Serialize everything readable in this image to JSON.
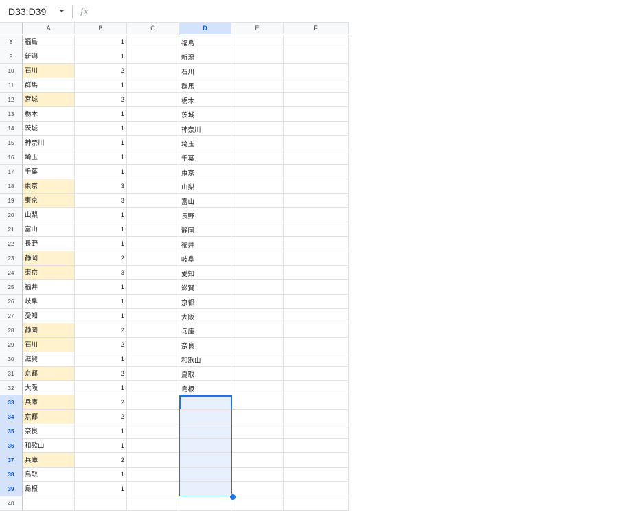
{
  "name_box": {
    "value": "D33:D39"
  },
  "formula_bar": {
    "fx_label": "fx",
    "value": ""
  },
  "columns": [
    "A",
    "B",
    "C",
    "D",
    "E",
    "F"
  ],
  "rows": [
    {
      "num": "8",
      "a": "福島",
      "b": "1",
      "d": "福島",
      "hl": false
    },
    {
      "num": "9",
      "a": "新潟",
      "b": "1",
      "d": "新潟",
      "hl": false
    },
    {
      "num": "10",
      "a": "石川",
      "b": "2",
      "d": "石川",
      "hl": true
    },
    {
      "num": "11",
      "a": "群馬",
      "b": "1",
      "d": "群馬",
      "hl": false
    },
    {
      "num": "12",
      "a": "宮城",
      "b": "2",
      "d": "栃木",
      "hl": true
    },
    {
      "num": "13",
      "a": "栃木",
      "b": "1",
      "d": "茨城",
      "hl": false
    },
    {
      "num": "14",
      "a": "茨城",
      "b": "1",
      "d": "神奈川",
      "hl": false
    },
    {
      "num": "15",
      "a": "神奈川",
      "b": "1",
      "d": "埼玉",
      "hl": false
    },
    {
      "num": "16",
      "a": "埼玉",
      "b": "1",
      "d": "千葉",
      "hl": false
    },
    {
      "num": "17",
      "a": "千葉",
      "b": "1",
      "d": "東京",
      "hl": false
    },
    {
      "num": "18",
      "a": "東京",
      "b": "3",
      "d": "山梨",
      "hl": true
    },
    {
      "num": "19",
      "a": "東京",
      "b": "3",
      "d": "富山",
      "hl": true
    },
    {
      "num": "20",
      "a": "山梨",
      "b": "1",
      "d": "長野",
      "hl": false
    },
    {
      "num": "21",
      "a": "富山",
      "b": "1",
      "d": "静岡",
      "hl": false
    },
    {
      "num": "22",
      "a": "長野",
      "b": "1",
      "d": "福井",
      "hl": false
    },
    {
      "num": "23",
      "a": "静岡",
      "b": "2",
      "d": "岐阜",
      "hl": true
    },
    {
      "num": "24",
      "a": "東京",
      "b": "3",
      "d": "愛知",
      "hl": true
    },
    {
      "num": "25",
      "a": "福井",
      "b": "1",
      "d": "滋賀",
      "hl": false
    },
    {
      "num": "26",
      "a": "岐阜",
      "b": "1",
      "d": "京都",
      "hl": false
    },
    {
      "num": "27",
      "a": "愛知",
      "b": "1",
      "d": "大阪",
      "hl": false
    },
    {
      "num": "28",
      "a": "静岡",
      "b": "2",
      "d": "兵庫",
      "hl": true
    },
    {
      "num": "29",
      "a": "石川",
      "b": "2",
      "d": "奈良",
      "hl": true
    },
    {
      "num": "30",
      "a": "滋賀",
      "b": "1",
      "d": "和歌山",
      "hl": false
    },
    {
      "num": "31",
      "a": "京都",
      "b": "2",
      "d": "鳥取",
      "hl": true
    },
    {
      "num": "32",
      "a": "大阪",
      "b": "1",
      "d": "島根",
      "hl": false
    },
    {
      "num": "33",
      "a": "兵庫",
      "b": "2",
      "d": "",
      "hl": true
    },
    {
      "num": "34",
      "a": "京都",
      "b": "2",
      "d": "",
      "hl": true
    },
    {
      "num": "35",
      "a": "奈良",
      "b": "1",
      "d": "",
      "hl": false
    },
    {
      "num": "36",
      "a": "和歌山",
      "b": "1",
      "d": "",
      "hl": false
    },
    {
      "num": "37",
      "a": "兵庫",
      "b": "2",
      "d": "",
      "hl": true
    },
    {
      "num": "38",
      "a": "鳥取",
      "b": "1",
      "d": "",
      "hl": false
    },
    {
      "num": "39",
      "a": "島根",
      "b": "1",
      "d": "",
      "hl": false
    },
    {
      "num": "40",
      "a": "",
      "b": "",
      "d": "",
      "hl": false
    }
  ],
  "selected_rows": [
    "33",
    "34",
    "35",
    "36",
    "37",
    "38",
    "39"
  ],
  "selected_column": "D"
}
